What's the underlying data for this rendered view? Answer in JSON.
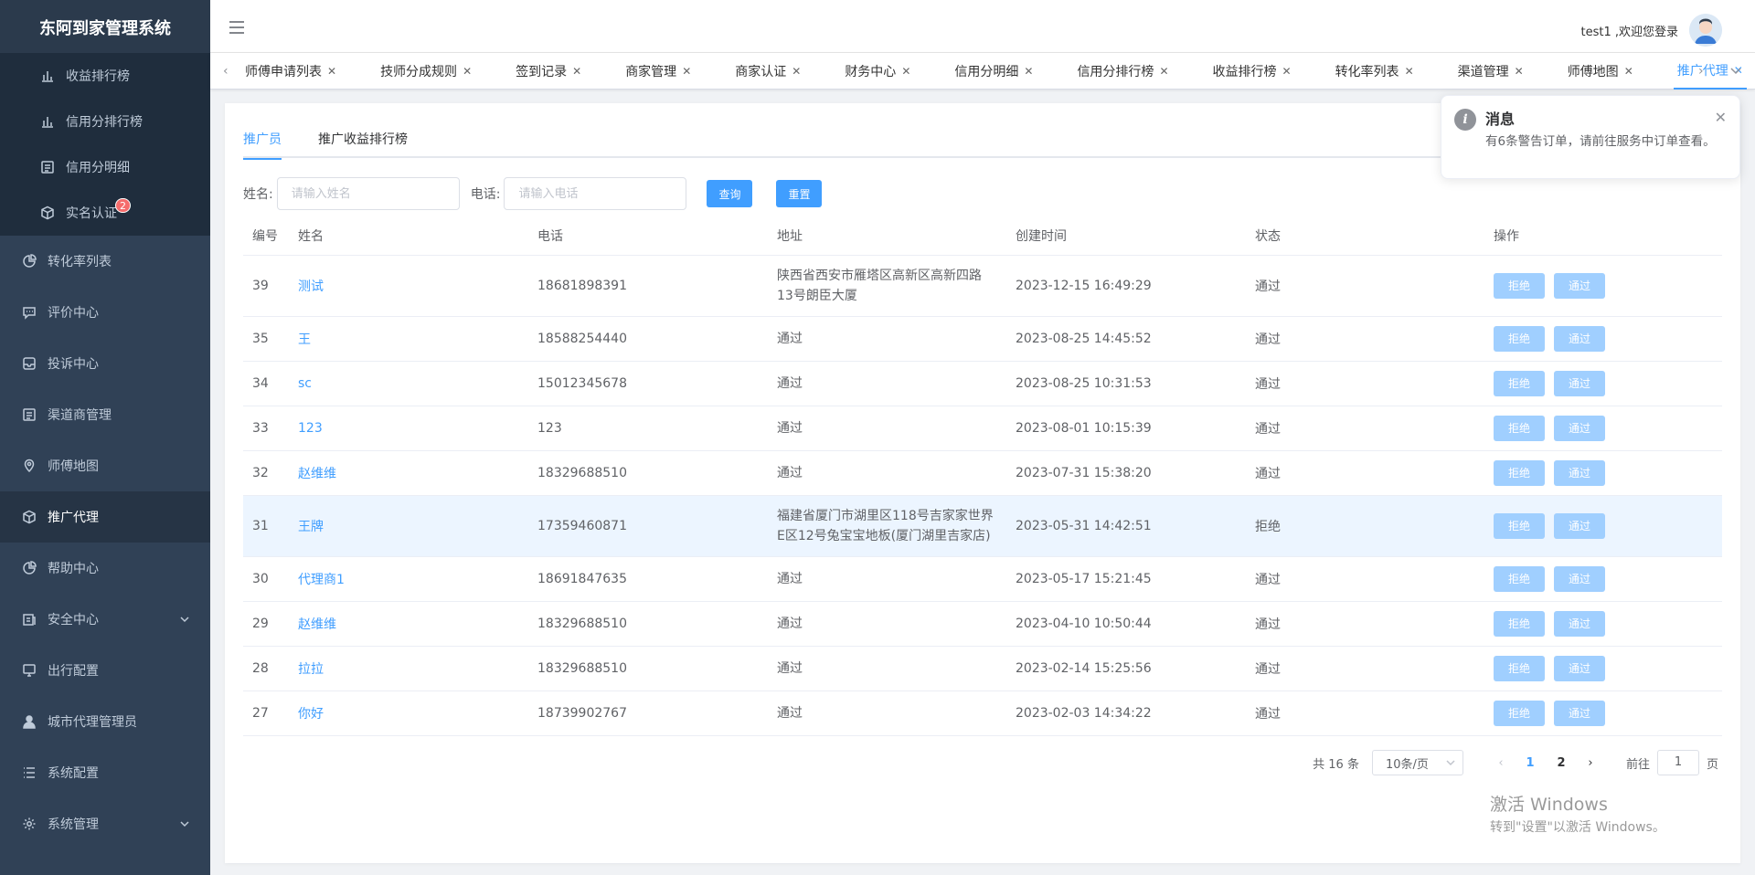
{
  "app": {
    "title": "东阿到家管理系统"
  },
  "sidebar": {
    "submenu": [
      {
        "label": "收益排行榜",
        "icon": "bar-chart-icon"
      },
      {
        "label": "信用分排行榜",
        "icon": "bar-chart-icon"
      },
      {
        "label": "信用分明细",
        "icon": "list-icon"
      },
      {
        "label": "实名认证",
        "icon": "box-icon",
        "badge": "2"
      }
    ],
    "items": [
      {
        "label": "转化率列表",
        "icon": "pie-chart-icon"
      },
      {
        "label": "评价中心",
        "icon": "comment-icon"
      },
      {
        "label": "投诉中心",
        "icon": "inbox-icon"
      },
      {
        "label": "渠道商管理",
        "icon": "list-icon"
      },
      {
        "label": "师傅地图",
        "icon": "location-icon"
      },
      {
        "label": "推广代理",
        "icon": "box-icon"
      },
      {
        "label": "帮助中心",
        "icon": "pie-chart-icon"
      },
      {
        "label": "安全中心",
        "icon": "document-icon"
      },
      {
        "label": "出行配置",
        "icon": "monitor-icon"
      },
      {
        "label": "城市代理管理员",
        "icon": "user-icon"
      },
      {
        "label": "系统配置",
        "icon": "menu-list-icon"
      },
      {
        "label": "系统管理",
        "icon": "gear-icon"
      }
    ]
  },
  "header": {
    "welcome": "test1 ,欢迎您登录"
  },
  "tags": [
    {
      "label": "师傅申请列表"
    },
    {
      "label": "技师分成规则"
    },
    {
      "label": "签到记录"
    },
    {
      "label": "商家管理"
    },
    {
      "label": "商家认证"
    },
    {
      "label": "财务中心"
    },
    {
      "label": "信用分明细"
    },
    {
      "label": "信用分排行榜"
    },
    {
      "label": "收益排行榜"
    },
    {
      "label": "转化率列表"
    },
    {
      "label": "渠道管理"
    },
    {
      "label": "师傅地图"
    },
    {
      "label": "推广代理"
    }
  ],
  "tabs": {
    "promoter": "推广员",
    "ranking": "推广收益排行榜"
  },
  "filter": {
    "name_label": "姓名:",
    "name_placeholder": "请输入姓名",
    "phone_label": "电话:",
    "phone_placeholder": "请输入电话",
    "query": "查询",
    "reset": "重置"
  },
  "table": {
    "headers": {
      "id": "编号",
      "name": "姓名",
      "phone": "电话",
      "address": "地址",
      "created": "创建时间",
      "status": "状态",
      "ops": "操作"
    },
    "reject": "拒绝",
    "approve": "通过",
    "rows": [
      {
        "id": "39",
        "name": "测试",
        "phone": "18681898391",
        "address": "陕西省西安市雁塔区高新区高新四路13号朗臣大厦",
        "created": "2023-12-15 16:49:29",
        "status": "通过"
      },
      {
        "id": "35",
        "name": "王",
        "phone": "18588254440",
        "address": "通过",
        "created": "2023-08-25 14:45:52",
        "status": "通过"
      },
      {
        "id": "34",
        "name": "sc",
        "phone": "15012345678",
        "address": "通过",
        "created": "2023-08-25 10:31:53",
        "status": "通过"
      },
      {
        "id": "33",
        "name": "123",
        "phone": "123",
        "address": "通过",
        "created": "2023-08-01 10:15:39",
        "status": "通过"
      },
      {
        "id": "32",
        "name": "赵维维",
        "phone": "18329688510",
        "address": "通过",
        "created": "2023-07-31 15:38:20",
        "status": "通过"
      },
      {
        "id": "31",
        "name": "王牌",
        "phone": "17359460871",
        "address": "福建省厦门市湖里区118号吉家家世界E区12号兔宝宝地板(厦门湖里吉家店)",
        "created": "2023-05-31 14:42:51",
        "status": "拒绝"
      },
      {
        "id": "30",
        "name": "代理商1",
        "phone": "18691847635",
        "address": "通过",
        "created": "2023-05-17 15:21:45",
        "status": "通过"
      },
      {
        "id": "29",
        "name": "赵维维",
        "phone": "18329688510",
        "address": "通过",
        "created": "2023-04-10 10:50:44",
        "status": "通过"
      },
      {
        "id": "28",
        "name": "拉拉",
        "phone": "18329688510",
        "address": "通过",
        "created": "2023-02-14 15:25:56",
        "status": "通过"
      },
      {
        "id": "27",
        "name": "你好",
        "phone": "18739902767",
        "address": "通过",
        "created": "2023-02-03 14:34:22",
        "status": "通过"
      }
    ]
  },
  "pagination": {
    "total": "共 16 条",
    "page_size": "10条/页",
    "pages": [
      "1",
      "2"
    ],
    "current": "1",
    "goto_prefix": "前往",
    "goto_value": "1",
    "goto_suffix": "页"
  },
  "notification": {
    "title": "消息",
    "message": "有6条警告订单，请前往服务中订单查看。"
  },
  "watermark": {
    "line1": "激活 Windows",
    "line2": "转到\"设置\"以激活 Windows。"
  },
  "colors": {
    "primary": "#409eff",
    "sidebar_bg": "#304156",
    "disabled_btn": "#a0cfff"
  }
}
